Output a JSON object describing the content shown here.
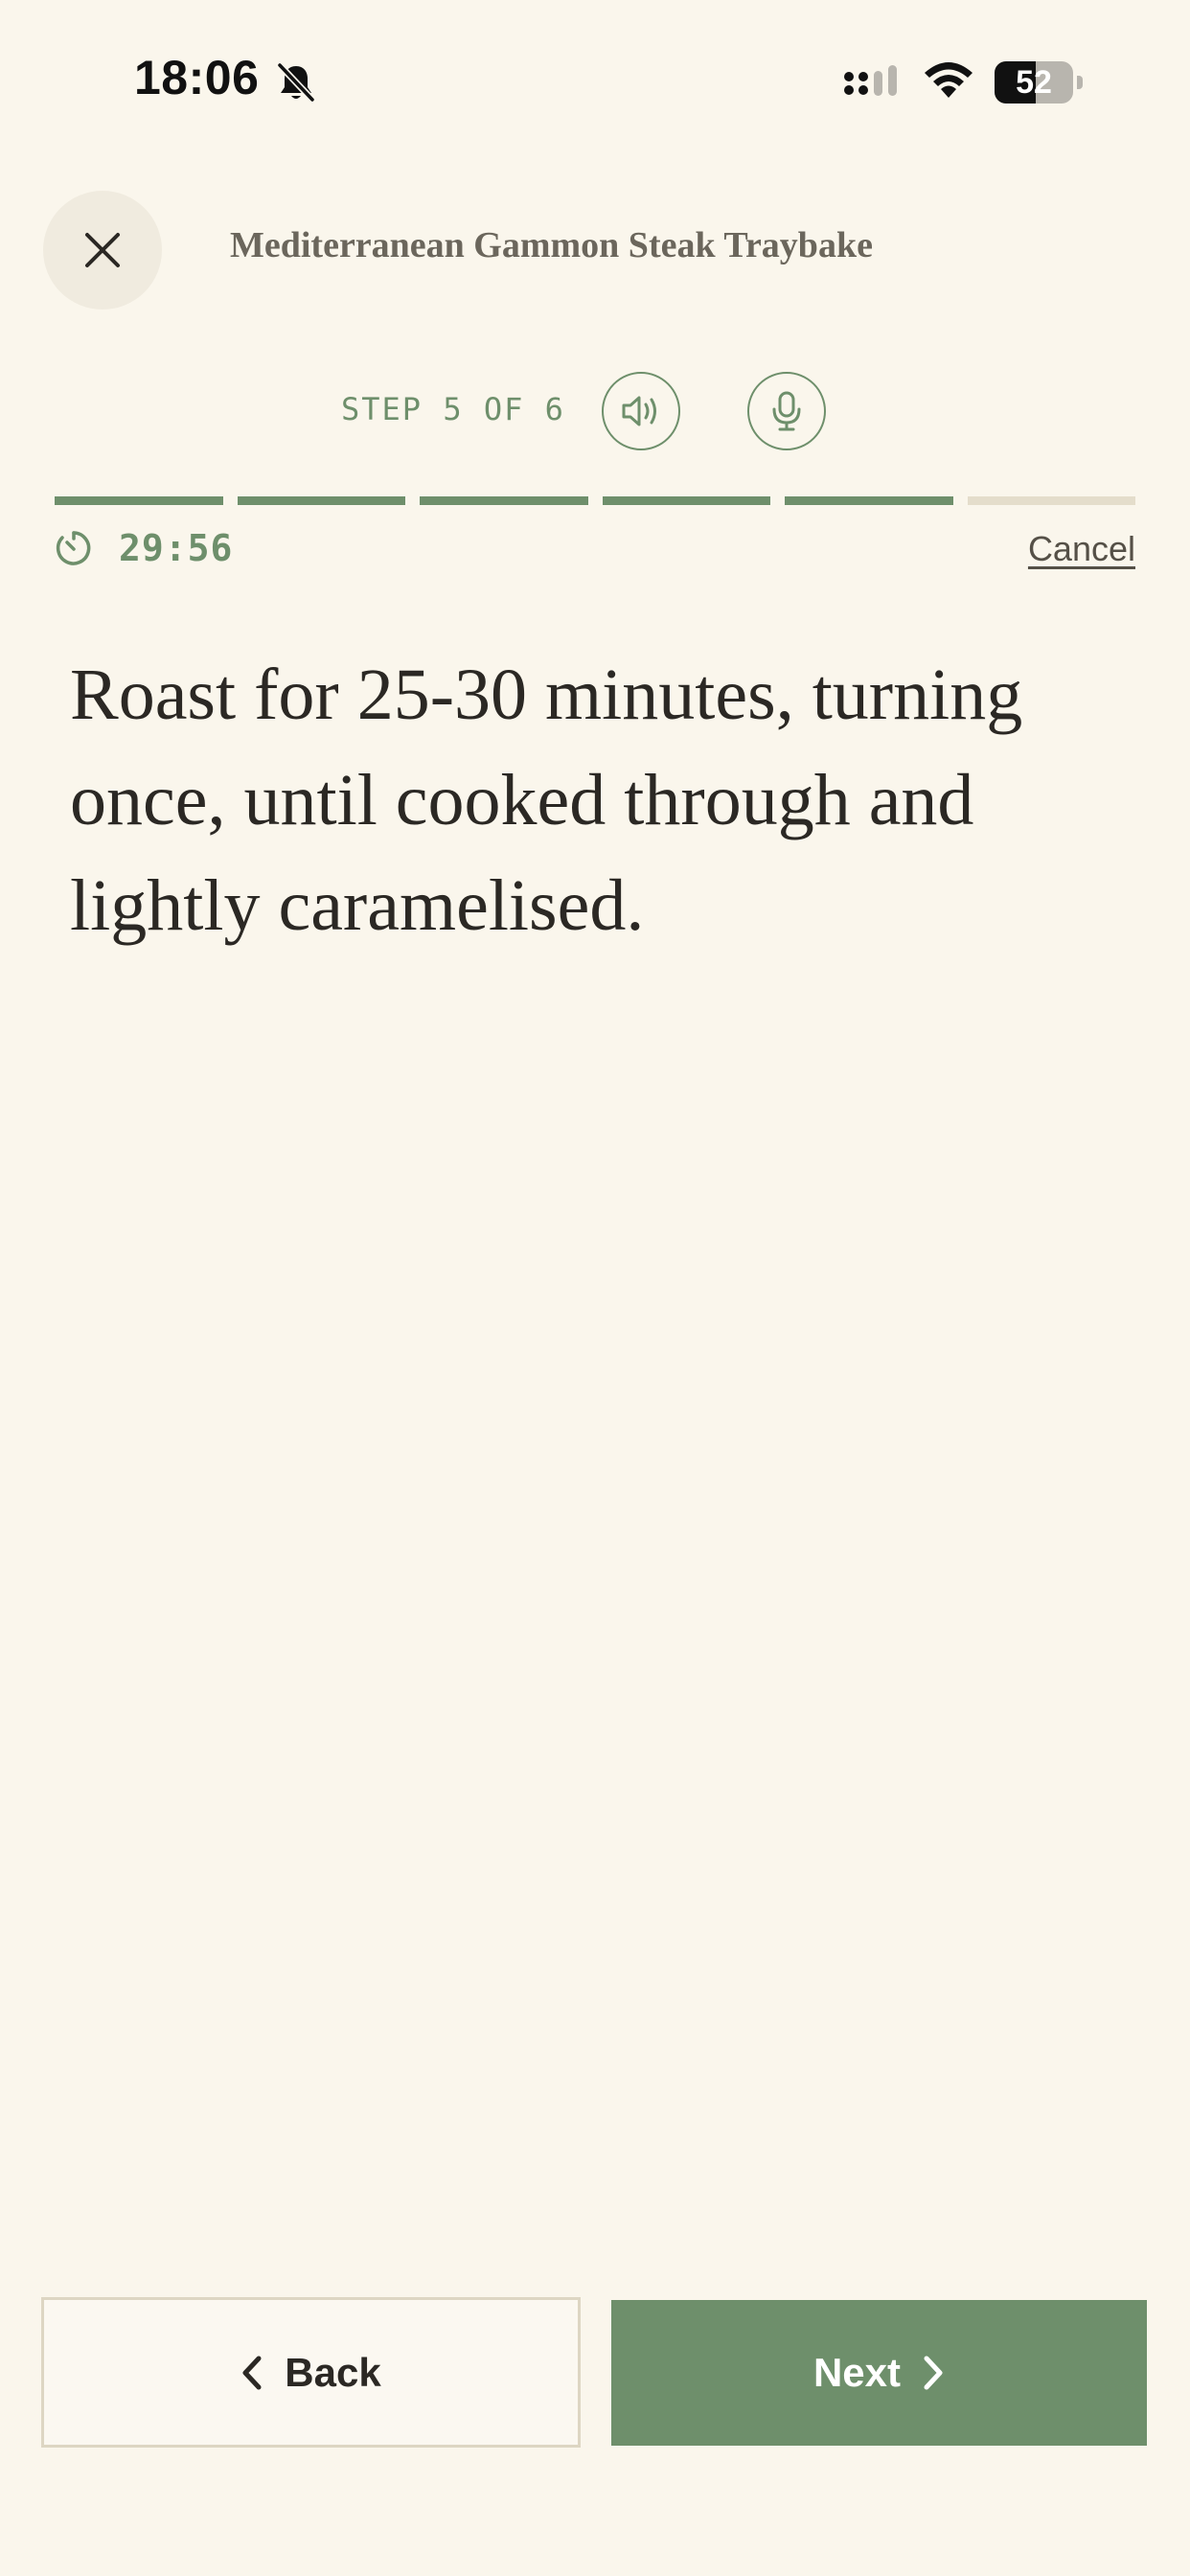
{
  "status_bar": {
    "time": "18:06",
    "battery_level": "52",
    "battery_fraction": 0.52,
    "icons": [
      "bell-off-icon",
      "signal-icon",
      "wifi-icon",
      "battery-icon"
    ]
  },
  "header": {
    "close_icon": "close-icon",
    "recipe_title": "Mediterranean Gammon Steak Traybake"
  },
  "step": {
    "label": "STEP 5 OF 6",
    "current": 5,
    "total": 6,
    "speaker_icon": "speaker-icon",
    "mic_icon": "microphone-icon"
  },
  "progress": {
    "segments_completed": 5,
    "segments_total": 6
  },
  "timer": {
    "icon": "timer-icon",
    "value": "29:56",
    "cancel_label": "Cancel"
  },
  "instruction": {
    "text": "Roast for 25-30 minutes, turning once, until cooked through and lightly caramelised."
  },
  "navigation": {
    "back_label": "Back",
    "next_label": "Next"
  },
  "colors": {
    "background": "#faf6ec",
    "accent_green": "#6e8f6b",
    "text_dark": "#2b2824",
    "progress_inactive": "#e4ddcb"
  }
}
